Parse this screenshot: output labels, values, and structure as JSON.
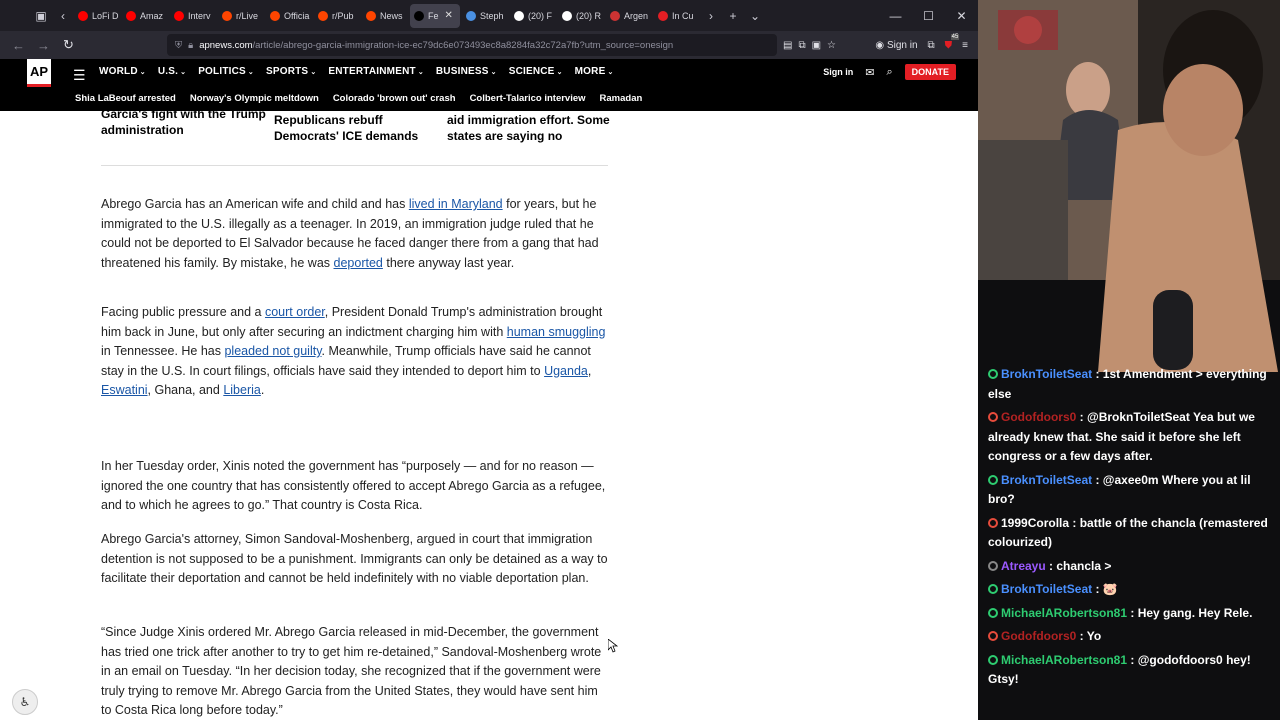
{
  "browser": {
    "tabs": [
      {
        "label": "LoFi D",
        "color": "#ff0000"
      },
      {
        "label": "Amaz",
        "color": "#ff0000"
      },
      {
        "label": "Interv",
        "color": "#ff0000"
      },
      {
        "label": "r/Live",
        "color": "#ff4500"
      },
      {
        "label": "Officia",
        "color": "#ff4500"
      },
      {
        "label": "r/Pub",
        "color": "#ff4500"
      },
      {
        "label": "News",
        "color": "#ff4500"
      },
      {
        "label": "Fe",
        "color": "#000000",
        "active": true
      },
      {
        "label": "Steph",
        "color": "#4a90e2"
      },
      {
        "label": "(20) F",
        "color": "#ffffff"
      },
      {
        "label": "(20) R",
        "color": "#ffffff"
      },
      {
        "label": "Argen",
        "color": "#cc3333"
      },
      {
        "label": "In Cu",
        "color": "#e31e24"
      }
    ],
    "url_domain": "apnews.com",
    "url_path": "/article/abrego-garcia-immigration-ice-ec79dc6e073493ec8a8284fa32c72a7fb?utm_source=onesign",
    "sign_in": "Sign in",
    "ext_badge": "45"
  },
  "ap": {
    "logo": "AP",
    "sections": [
      "WORLD",
      "U.S.",
      "POLITICS",
      "SPORTS",
      "ENTERTAINMENT",
      "BUSINESS",
      "SCIENCE",
      "MORE"
    ],
    "sign_in": "Sign in",
    "donate": "DONATE",
    "trending": [
      "Shia LaBeouf arrested",
      "Norway's Olympic meltdown",
      "Colorado 'brown out' crash",
      "Colbert-Talarico interview",
      "Ramadan"
    ]
  },
  "related": [
    {
      "line1": "Garcia's fight with the Trump",
      "line2": "administration"
    },
    {
      "line1": "Republicans rebuff",
      "line2": "Democrats' ICE demands"
    },
    {
      "line1": "aid immigration effort. Some",
      "line2": "states are saying no"
    }
  ],
  "article": {
    "p1_a": "Abrego Garcia has an American wife and child and has ",
    "p1_link1": "lived in Maryland",
    "p1_b": " for years, but he immigrated to the U.S. illegally as a teenager. In 2019, an immigration judge ruled that he could not be deported to El Salvador because he faced danger there from a gang that had threatened his family. By mistake, he was ",
    "p1_link2": "deported",
    "p1_c": " there anyway last year.",
    "p2_a": "Facing public pressure and a ",
    "p2_link1": "court order",
    "p2_b": ", President Donald Trump's administration brought him back in June, but only after securing an indictment charging him with ",
    "p2_link2": "human smuggling",
    "p2_c": " in Tennessee. He has ",
    "p2_link3": "pleaded not guilty",
    "p2_d": ". Meanwhile, Trump officials have said he cannot stay in the U.S. In court filings, officials have said they intended to deport him to ",
    "p2_link4": "Uganda",
    "p2_e": ", ",
    "p2_link5": "Eswatini",
    "p2_f": ", Ghana, and ",
    "p2_link6": "Liberia",
    "p2_g": ".",
    "p3": "In her Tuesday order, Xinis noted the government has “purposely — and for no reason — ignored the one country that has consistently offered to accept Abrego Garcia as a refugee, and to which he agrees to go.” That country is Costa Rica.",
    "p4": "Abrego Garcia's attorney, Simon Sandoval-Moshenberg, argued in court that immigration detention is not supposed to be a punishment. Immigrants can only be detained as a way to facilitate their deportation and cannot be held indefinitely with no viable deportation plan.",
    "p5": "“Since Judge Xinis ordered Mr. Abrego Garcia released in mid-December, the government has tried one trick after another to try to get him re-detained,” Sandoval-Moshenberg wrote in an email on Tuesday. “In her decision today, she recognized that if the government were truly trying to remove Mr. Abrego Garcia from the United States, they would have sent him to Costa Rica long before today.”"
  },
  "chat": [
    {
      "user": "BroknToiletSeat",
      "color": "#4a90ff",
      "text": "1st Amendment > everything else"
    },
    {
      "user": "Godofdoors0",
      "color": "#b22222",
      "text": "@BroknToiletSeat Yea but we already knew that. She said it before she left congress or a few days after."
    },
    {
      "user": "BroknToiletSeat",
      "color": "#4a90ff",
      "text": "@axee0m Where you at lil bro?"
    },
    {
      "user": "1999Corolla",
      "color": "#ffffff",
      "text": "battle of the chancla (remastered colourized)"
    },
    {
      "user": "Atreayu",
      "color": "#9b59ff",
      "text": "chancla >"
    },
    {
      "user": "BroknToiletSeat",
      "color": "#4a90ff",
      "text": "🐷"
    },
    {
      "user": "MichaelARobertson81",
      "color": "#2ecc71",
      "text": "Hey gang. Hey Rele."
    },
    {
      "user": "Godofdoors0",
      "color": "#b22222",
      "text": "Yo"
    },
    {
      "user": "MichaelARobertson81",
      "color": "#2ecc71",
      "text": "@godofdoors0 hey! Gtsy!"
    }
  ]
}
